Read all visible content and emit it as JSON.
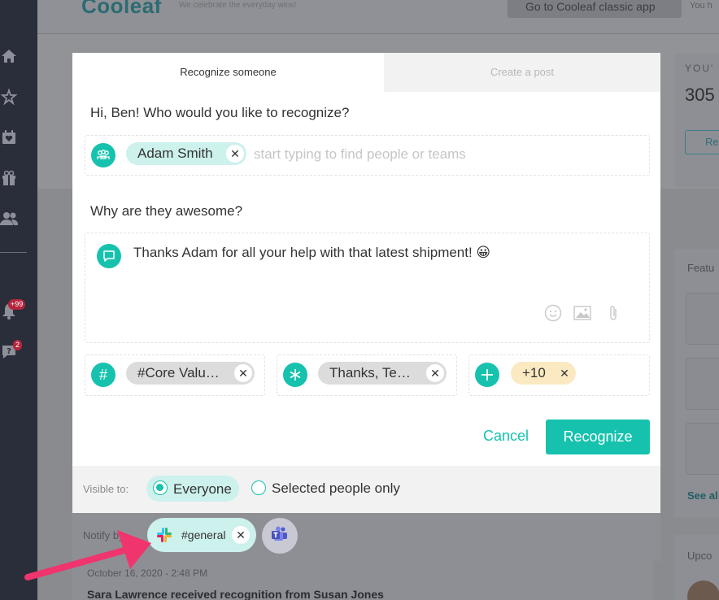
{
  "app": {
    "logo": "Cooleaf",
    "tagline": "We celebrate the everyday wins!",
    "classic_link": "Go to Cooleaf classic app",
    "top_right_text": "You h"
  },
  "sidebar": {
    "notifications_badge": "+99",
    "help_badge": "2"
  },
  "right_panel": {
    "points_label": "YOU'",
    "points_value": "305",
    "redeem_button": "Re",
    "featured_label": "Featu",
    "see_all": "See al",
    "upcoming_label": "Upco"
  },
  "feed": {
    "date": "October 16, 2020 - 2:48 PM",
    "title": "Sara Lawrence received recognition from Susan Jones"
  },
  "modal": {
    "tabs": [
      {
        "label": "Recognize someone",
        "active": true
      },
      {
        "label": "Create a post",
        "active": false
      }
    ],
    "recipient_question": "Hi, Ben! Who would you like to recognize?",
    "recipient_chip": "Adam Smith",
    "recipient_placeholder": "start typing to find people or teams",
    "reason_question": "Why are they awesome?",
    "message": "Thanks Adam for all your help with that latest shipment! 😀",
    "core_value_chip": "#Core Valu…",
    "badge_chip": "Thanks, Te…",
    "points_chip": "+10",
    "cancel_label": "Cancel",
    "recognize_label": "Recognize"
  },
  "visibility": {
    "label": "Visible to:",
    "options": [
      {
        "label": "Everyone",
        "selected": true
      },
      {
        "label": "Selected people only",
        "selected": false
      }
    ]
  },
  "notify": {
    "label": "Notify by:",
    "slack_channel": "#general"
  },
  "colors": {
    "accent": "#16c2ad",
    "arrow": "#f0346e"
  }
}
